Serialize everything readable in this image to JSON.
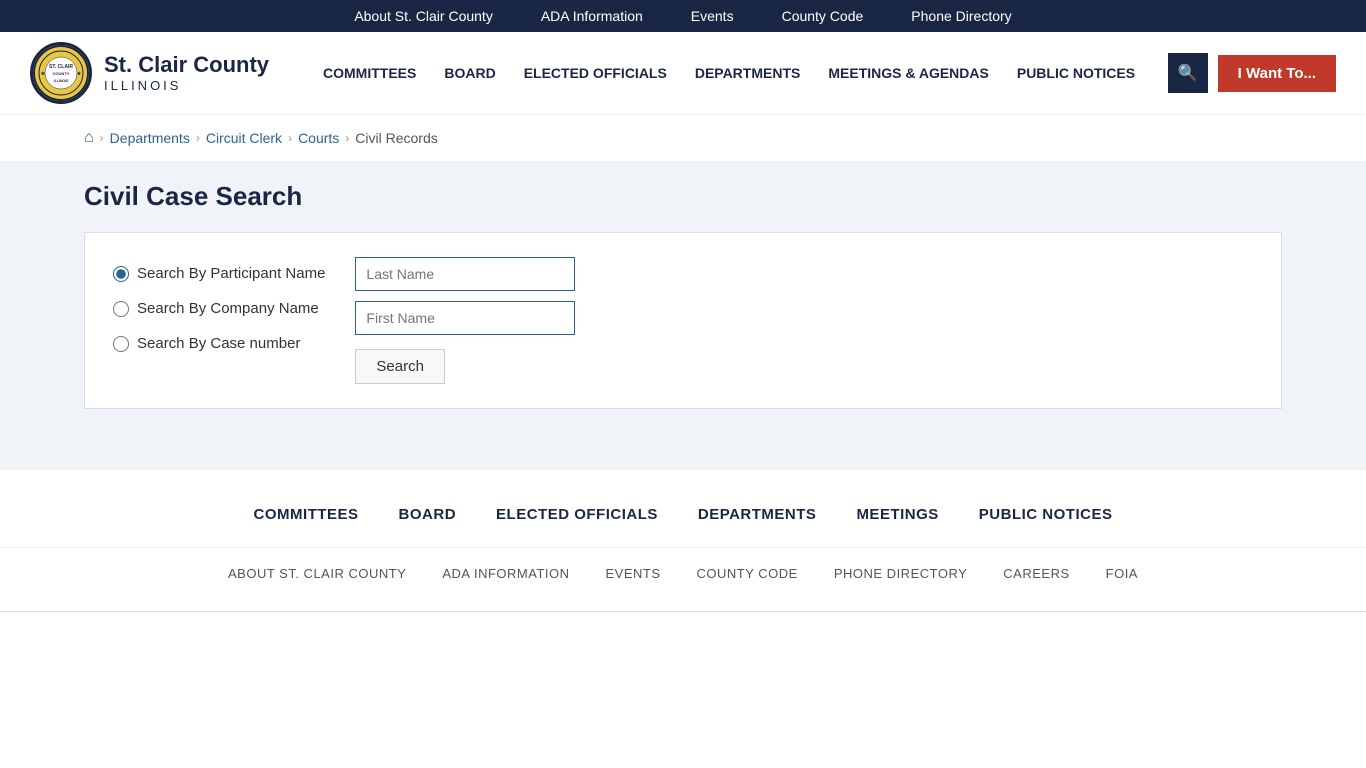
{
  "topbar": {
    "links": [
      {
        "id": "about",
        "label": "About St. Clair County"
      },
      {
        "id": "ada",
        "label": "ADA Information"
      },
      {
        "id": "events",
        "label": "Events"
      },
      {
        "id": "county-code",
        "label": "County Code"
      },
      {
        "id": "phone-directory",
        "label": "Phone Directory"
      }
    ]
  },
  "header": {
    "logo": {
      "county": "St. Clair County",
      "state": "ILLINOIS"
    },
    "nav": [
      {
        "id": "committees",
        "label": "COMMITTEES"
      },
      {
        "id": "board",
        "label": "BOARD"
      },
      {
        "id": "elected-officials",
        "label": "ELECTED OFFICIALS"
      },
      {
        "id": "departments",
        "label": "DEPARTMENTS"
      },
      {
        "id": "meetings-agendas",
        "label": "MEETINGS & AGENDAS"
      },
      {
        "id": "public-notices",
        "label": "PUBLIC NOTICES"
      }
    ],
    "search_aria": "Search",
    "i_want_to": "I Want To..."
  },
  "breadcrumb": {
    "home_label": "🏠",
    "items": [
      {
        "label": "Departments",
        "url": "#"
      },
      {
        "label": "Circuit Clerk",
        "url": "#"
      },
      {
        "label": "Courts",
        "url": "#"
      },
      {
        "label": "Civil Records",
        "url": null
      }
    ]
  },
  "main": {
    "title": "Civil Case Search",
    "search_options": [
      {
        "id": "participant",
        "label": "Search By Participant Name",
        "checked": true
      },
      {
        "id": "company",
        "label": "Search By Company Name",
        "checked": false
      },
      {
        "id": "case-number",
        "label": "Search By Case number",
        "checked": false
      }
    ],
    "fields": {
      "last_name_placeholder": "Last Name",
      "first_name_placeholder": "First Name"
    },
    "search_button": "Search"
  },
  "footer": {
    "nav_top": [
      {
        "id": "committees",
        "label": "COMMITTEES"
      },
      {
        "id": "board",
        "label": "BOARD"
      },
      {
        "id": "elected-officials",
        "label": "ELECTED OFFICIALS"
      },
      {
        "id": "departments",
        "label": "DEPARTMENTS"
      },
      {
        "id": "meetings",
        "label": "MEETINGS"
      },
      {
        "id": "public-notices",
        "label": "PUBLIC NOTICES"
      }
    ],
    "nav_bottom": [
      {
        "id": "about",
        "label": "ABOUT ST. CLAIR COUNTY"
      },
      {
        "id": "ada",
        "label": "ADA INFORMATION"
      },
      {
        "id": "events",
        "label": "EVENTS"
      },
      {
        "id": "county-code",
        "label": "COUNTY CODE"
      },
      {
        "id": "phone-directory",
        "label": "PHONE DIRECTORY"
      },
      {
        "id": "careers",
        "label": "CAREERS"
      },
      {
        "id": "foia",
        "label": "FOIA"
      }
    ]
  }
}
